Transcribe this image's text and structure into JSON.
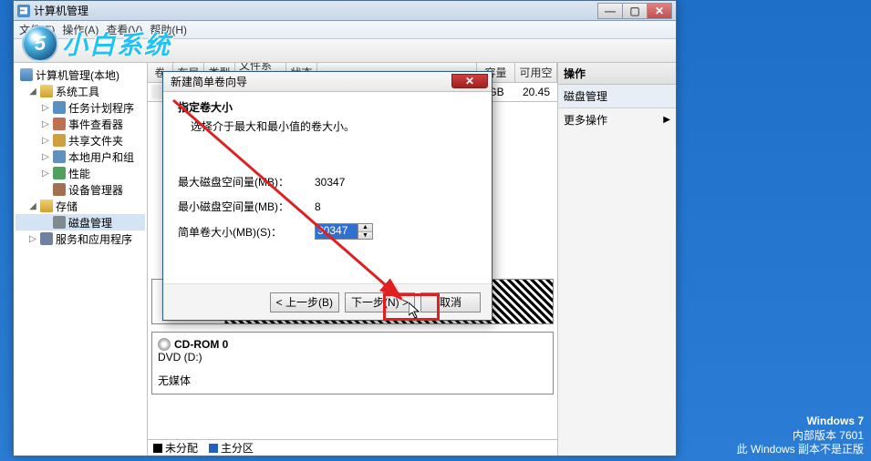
{
  "main_window": {
    "title": "计算机管理",
    "menu": {
      "file": "文件(F)",
      "action": "操作(A)",
      "view": "查看(V)",
      "help": "帮助(H)"
    }
  },
  "tree": {
    "root": "计算机管理(本地)",
    "systools": "系统工具",
    "task": "任务计划程序",
    "event": "事件查看器",
    "share": "共享文件夹",
    "users": "本地用户和组",
    "perf": "性能",
    "devmgr": "设备管理器",
    "storage": "存储",
    "diskmgmt": "磁盘管理",
    "services": "服务和应用程序"
  },
  "list_cols": {
    "vol": "卷",
    "layout": "布局",
    "type": "类型",
    "fs": "文件系统",
    "status": "状态",
    "capacity": "容量",
    "free": "可用空"
  },
  "visible_row": {
    "capacity_gb": "GB",
    "free": "20.45"
  },
  "right": {
    "header": "操作",
    "section": "磁盘管理",
    "more": "更多操作"
  },
  "disk": {
    "cdrom_title": "CD-ROM 0",
    "cdrom_sub": "DVD (D:)",
    "cdrom_status": "无媒体"
  },
  "legend": {
    "unalloc": "未分配",
    "primary": "主分区"
  },
  "dialog": {
    "title": "新建简单卷向导",
    "heading": "指定卷大小",
    "sub": "选择介于最大和最小值的卷大小。",
    "max_label": "最大磁盘空间量(MB)：",
    "max_val": "30347",
    "min_label": "最小磁盘空间量(MB)：",
    "min_val": "8",
    "size_label": "简单卷大小(MB)(S)：",
    "size_val": "30347",
    "back": "< 上一步(B)",
    "next": "下一步(N) >",
    "cancel": "取消"
  },
  "desktop": {
    "os": "Windows 7",
    "build": "内部版本 7601",
    "genuine": "此 Windows 副本不是正版"
  }
}
